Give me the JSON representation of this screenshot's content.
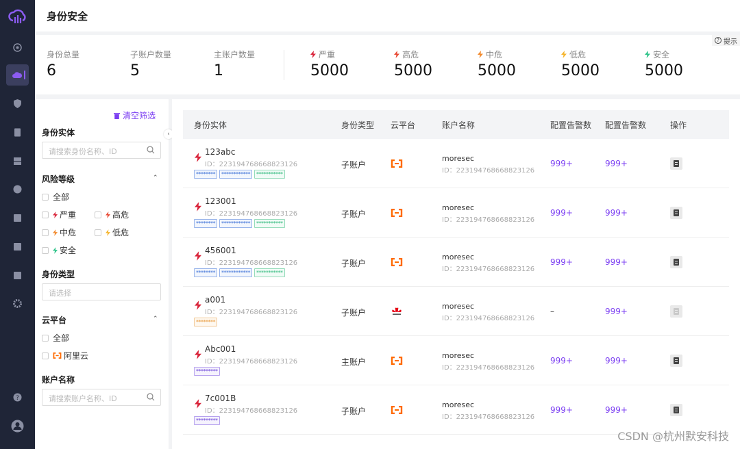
{
  "page": {
    "title": "身份安全"
  },
  "tip": {
    "label": "提示"
  },
  "stats": {
    "identity_total": {
      "label": "身份总量",
      "value": "6"
    },
    "sub_accounts": {
      "label": "子账户数量",
      "value": "5"
    },
    "main_accounts": {
      "label": "主账户数量",
      "value": "1"
    },
    "risk": [
      {
        "label": "严重",
        "value": "5000",
        "color": "#d9253b"
      },
      {
        "label": "高危",
        "value": "5000",
        "color": "#e84a35"
      },
      {
        "label": "中危",
        "value": "5000",
        "color": "#f28a2e"
      },
      {
        "label": "低危",
        "value": "5000",
        "color": "#f5b52e"
      },
      {
        "label": "安全",
        "value": "5000",
        "color": "#2fc48a"
      }
    ]
  },
  "filter": {
    "clear_label": "清空筛选",
    "entity": {
      "title": "身份实体",
      "placeholder": "请搜索身份名称、ID"
    },
    "risk": {
      "title": "风险等级",
      "options": [
        "全部",
        "严重",
        "高危",
        "中危",
        "低危",
        "安全"
      ]
    },
    "identity_type": {
      "title": "身份类型",
      "placeholder": "请选择"
    },
    "cloud": {
      "title": "云平台",
      "options": [
        "全部",
        "阿里云"
      ]
    },
    "account": {
      "title": "账户名称",
      "placeholder": "请搜索账户名称、ID"
    }
  },
  "table": {
    "headers": [
      "身份实体",
      "身份类型",
      "云平台",
      "账户名称",
      "配置告警数",
      "配置告警数",
      "操作"
    ],
    "rows": [
      {
        "name": "123abc",
        "id": "ID：223194768668823126",
        "tags": [
          "********",
          "************",
          "***********"
        ],
        "type": "子账户",
        "cloud": "aliyun",
        "account": "moresec",
        "account_id": "ID：223194768668823126",
        "c1": "999+",
        "c2": "999+"
      },
      {
        "name": "123001",
        "id": "ID：223194768668823126",
        "tags": [
          "********",
          "************",
          "***********"
        ],
        "type": "子账户",
        "cloud": "aliyun",
        "account": "moresec",
        "account_id": "ID：223194768668823126",
        "c1": "999+",
        "c2": "999+"
      },
      {
        "name": "456001",
        "id": "ID：223194768668823126",
        "tags": [
          "********",
          "************",
          "***********"
        ],
        "type": "子账户",
        "cloud": "aliyun",
        "account": "moresec",
        "account_id": "ID：223194768668823126",
        "c1": "999+",
        "c2": "999+"
      },
      {
        "name": "a001",
        "id": "ID：223194768668823126",
        "tags": [
          "********"
        ],
        "type": "子账户",
        "cloud": "huawei",
        "account": "moresec",
        "account_id": "ID：223194768668823126",
        "c1": "–",
        "c2": "999+"
      },
      {
        "name": "Abc001",
        "id": "ID：223194768668823126",
        "tags": [
          "*********"
        ],
        "type": "主账户",
        "cloud": "aliyun",
        "account": "moresec",
        "account_id": "ID：223194768668823126",
        "c1": "999+",
        "c2": "999+"
      },
      {
        "name": "7c001B",
        "id": "ID：223194768668823126",
        "tags": [
          "*********"
        ],
        "type": "子账户",
        "cloud": "aliyun",
        "account": "moresec",
        "account_id": "ID：223194768668823126",
        "c1": "999+",
        "c2": "999+"
      }
    ]
  },
  "watermark": "CSDN @杭州默安科技"
}
